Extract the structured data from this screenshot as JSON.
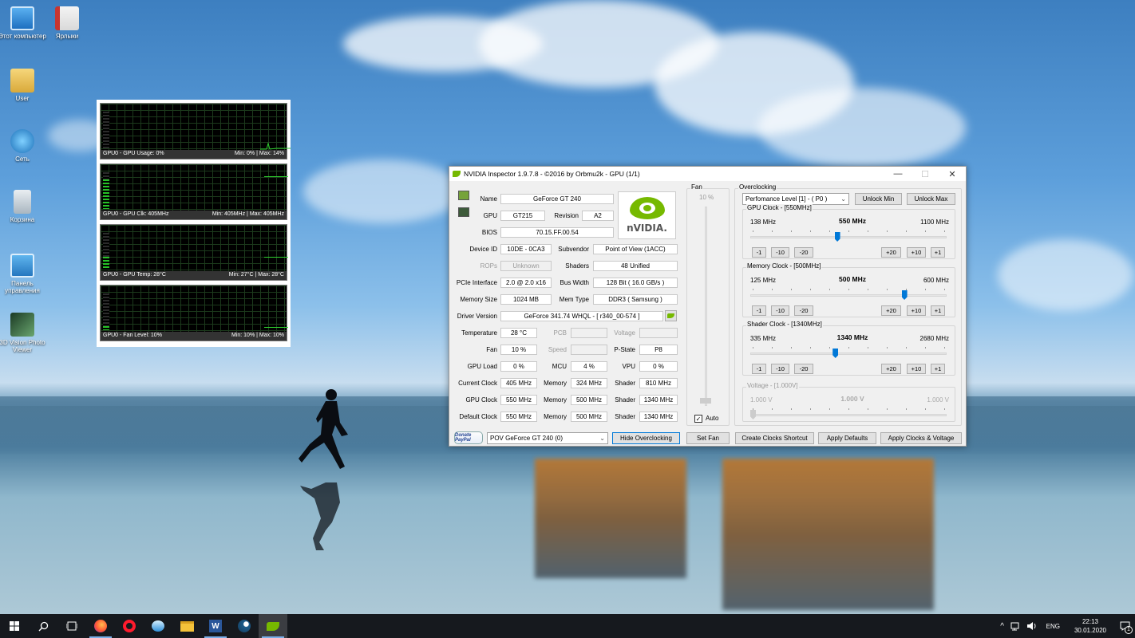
{
  "desktop": {
    "icons": [
      {
        "label": "Этот компьютер"
      },
      {
        "label": "Ярлыки"
      },
      {
        "label": "User"
      },
      {
        "label": "Сеть"
      },
      {
        "label": "Корзина"
      },
      {
        "label": "Панель управления"
      },
      {
        "label": "3D Vision Photo Viewer"
      }
    ]
  },
  "gadget": {
    "graphs": [
      {
        "left": "GPU0 - GPU Usage: 0%",
        "right": "Min: 0% | Max: 14%",
        "level": 0
      },
      {
        "left": "GPU0 - GPU Clk: 405MHz",
        "right": "Min: 405MHz | Max: 405MHz",
        "level": 0.8
      },
      {
        "left": "GPU0 - GPU Temp: 28°C",
        "right": "Min: 27°C | Max: 28°C",
        "level": 0.35
      },
      {
        "left": "GPU0 - Fan Level: 10%",
        "right": "Min: 10% | Max: 10%",
        "level": 0.1
      }
    ]
  },
  "window": {
    "title": "NVIDIA Inspector 1.9.7.8 - ©2016 by Orbmu2k - GPU (1/1)",
    "minimize": "—",
    "maximize": "☐",
    "close": "✕",
    "info": {
      "name_label": "Name",
      "name": "GeForce GT 240",
      "gpu_label": "GPU",
      "gpu": "GT215",
      "revision_label": "Revision",
      "revision": "A2",
      "bios_label": "BIOS",
      "bios": "70.15.FF.00.54",
      "device_id_label": "Device ID",
      "device_id": "10DE - 0CA3",
      "subvendor_label": "Subvendor",
      "subvendor": "Point of View (1ACC)",
      "rops_label": "ROPs",
      "rops": "Unknown",
      "shaders_label": "Shaders",
      "shaders": "48 Unified",
      "pcie_label": "PCIe Interface",
      "pcie": "2.0 @ 2.0 x16",
      "bus_width_label": "Bus Width",
      "bus_width": "128 Bit ( 16.0 GB/s )",
      "memory_size_label": "Memory Size",
      "memory_size": "1024 MB",
      "mem_type_label": "Mem Type",
      "mem_type": "DDR3 ( Samsung )",
      "driver_label": "Driver Version",
      "driver": "GeForce 341.74 WHQL - [ r340_00-574 ]",
      "temperature_label": "Temperature",
      "temperature": "28 °C",
      "pcb_label": "PCB",
      "pcb": "",
      "voltage_label": "Voltage",
      "voltage": "",
      "fan_label": "Fan",
      "fan": "10 %",
      "speed_label": "Speed",
      "speed": "",
      "pstate_label": "P-State",
      "pstate": "P8",
      "gpu_load_label": "GPU Load",
      "gpu_load": "0 %",
      "mcu_label": "MCU",
      "mcu": "4 %",
      "vpu_label": "VPU",
      "vpu": "0 %",
      "current_clock_label": "Current Clock",
      "current_clock": "405 MHz",
      "current_memory_label": "Memory",
      "current_memory": "324 MHz",
      "current_shader_label": "Shader",
      "current_shader": "810 MHz",
      "gpu_clock_label": "GPU Clock",
      "gpu_clock": "550 MHz",
      "gpu_memory_label": "Memory",
      "gpu_memory": "500 MHz",
      "gpu_shader_label": "Shader",
      "gpu_shader": "1340 MHz",
      "default_clock_label": "Default Clock",
      "default_clock": "550 MHz",
      "default_memory_label": "Memory",
      "default_memory": "500 MHz",
      "default_shader_label": "Shader",
      "default_shader": "1340 MHz"
    },
    "logo_text": "nVIDIA.",
    "fan_panel": {
      "title": "Fan",
      "value": "10 %",
      "auto_label": "Auto",
      "auto_checked": true
    },
    "overclocking": {
      "title": "Overclocking",
      "perf_level": "Perfomance Level [1] - ( P0 )",
      "unlock_min": "Unlock Min",
      "unlock_max": "Unlock Max",
      "sliders": [
        {
          "title": "GPU Clock - [550MHz]",
          "min": "138 MHz",
          "value": "550 MHz",
          "max": "1100 MHz",
          "pos": 0.44,
          "enabled": true
        },
        {
          "title": "Memory Clock - [500MHz]",
          "min": "125 MHz",
          "value": "500 MHz",
          "max": "600 MHz",
          "pos": 0.79,
          "enabled": true
        },
        {
          "title": "Shader Clock - [1340MHz]",
          "min": "335 MHz",
          "value": "1340 MHz",
          "max": "2680 MHz",
          "pos": 0.43,
          "enabled": true
        },
        {
          "title": "Voltage - [1.000V]",
          "min": "1.000 V",
          "value": "1.000 V",
          "max": "1.000 V",
          "pos": 0,
          "enabled": false
        }
      ],
      "step_buttons": [
        "-1",
        "-10",
        "-20",
        "+20",
        "+10",
        "+1"
      ]
    },
    "bottom": {
      "donate": "Donate PayPal",
      "gpu_select": "POV GeForce GT 240 (0)",
      "hide_oc": "Hide Overclocking",
      "set_fan": "Set Fan",
      "create_shortcut": "Create Clocks Shortcut",
      "apply_defaults": "Apply Defaults",
      "apply_clocks": "Apply Clocks & Voltage"
    }
  },
  "taskbar": {
    "lang": "ENG",
    "time": "22:13",
    "date": "30.01.2020",
    "notifications": "1",
    "tray_arrow": "^"
  }
}
